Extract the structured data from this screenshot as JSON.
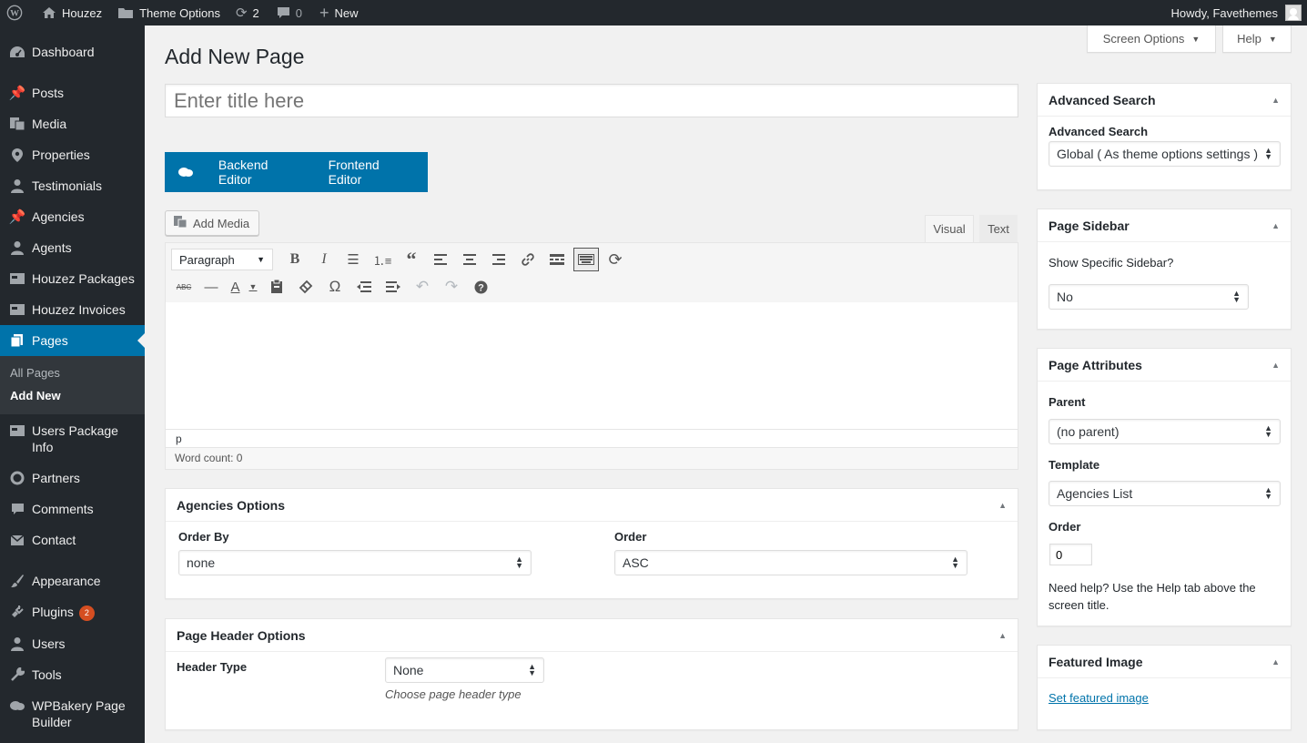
{
  "admin_bar": {
    "site_name": "Houzez",
    "theme_options": "Theme Options",
    "updates_count": "2",
    "comments_count": "0",
    "new_label": "New",
    "greeting": "Howdy, Favethemes"
  },
  "sidebar": {
    "items": [
      {
        "label": "Dashboard",
        "icon": "dashboard-icon"
      },
      {
        "label": "Posts",
        "icon": "pin-icon"
      },
      {
        "label": "Media",
        "icon": "media-icon"
      },
      {
        "label": "Properties",
        "icon": "location-icon"
      },
      {
        "label": "Testimonials",
        "icon": "user-icon"
      },
      {
        "label": "Agencies",
        "icon": "pin-icon"
      },
      {
        "label": "Agents",
        "icon": "user-icon"
      },
      {
        "label": "Houzez Packages",
        "icon": "package-icon"
      },
      {
        "label": "Houzez Invoices",
        "icon": "invoice-icon"
      },
      {
        "label": "Pages",
        "icon": "pages-icon"
      },
      {
        "label": "Users Package Info",
        "icon": "package-icon"
      },
      {
        "label": "Partners",
        "icon": "user-icon"
      },
      {
        "label": "Comments",
        "icon": "comment-icon"
      },
      {
        "label": "Contact",
        "icon": "mail-icon"
      },
      {
        "label": "Appearance",
        "icon": "brush-icon"
      },
      {
        "label": "Plugins",
        "icon": "plugin-icon",
        "badge": "2"
      },
      {
        "label": "Users",
        "icon": "user-icon"
      },
      {
        "label": "Tools",
        "icon": "wrench-icon"
      },
      {
        "label": "WPBakery Page Builder",
        "icon": "wpbakery-icon"
      }
    ],
    "pages_submenu": {
      "all_pages": "All Pages",
      "add_new": "Add New"
    }
  },
  "header": {
    "screen_options": "Screen Options",
    "help": "Help",
    "page_title": "Add New Page",
    "title_placeholder": "Enter title here"
  },
  "vc": {
    "backend": "Backend Editor",
    "frontend": "Frontend Editor"
  },
  "editor": {
    "add_media": "Add Media",
    "tab_visual": "Visual",
    "tab_text": "Text",
    "format_select": "Paragraph",
    "path": "p",
    "word_count": "Word count: 0"
  },
  "agencies_options": {
    "title": "Agencies Options",
    "order_by_label": "Order By",
    "order_by_value": "none",
    "order_label": "Order",
    "order_value": "ASC"
  },
  "page_header_options": {
    "title": "Page Header Options",
    "header_type_label": "Header Type",
    "header_type_value": "None",
    "header_type_hint": "Choose page header type"
  },
  "advanced_search": {
    "title": "Advanced Search",
    "label": "Advanced Search",
    "value": "Global ( As theme options settings )"
  },
  "page_sidebar": {
    "title": "Page Sidebar",
    "label": "Show Specific Sidebar?",
    "value": "No"
  },
  "page_attributes": {
    "title": "Page Attributes",
    "parent_label": "Parent",
    "parent_value": "(no parent)",
    "template_label": "Template",
    "template_value": "Agencies List",
    "order_label": "Order",
    "order_value": "0",
    "help_text": "Need help? Use the Help tab above the screen title."
  },
  "featured_image": {
    "title": "Featured Image",
    "link": "Set featured image"
  },
  "colors": {
    "admin_dark": "#23282d",
    "accent": "#0073aa",
    "badge": "#d54e21"
  }
}
